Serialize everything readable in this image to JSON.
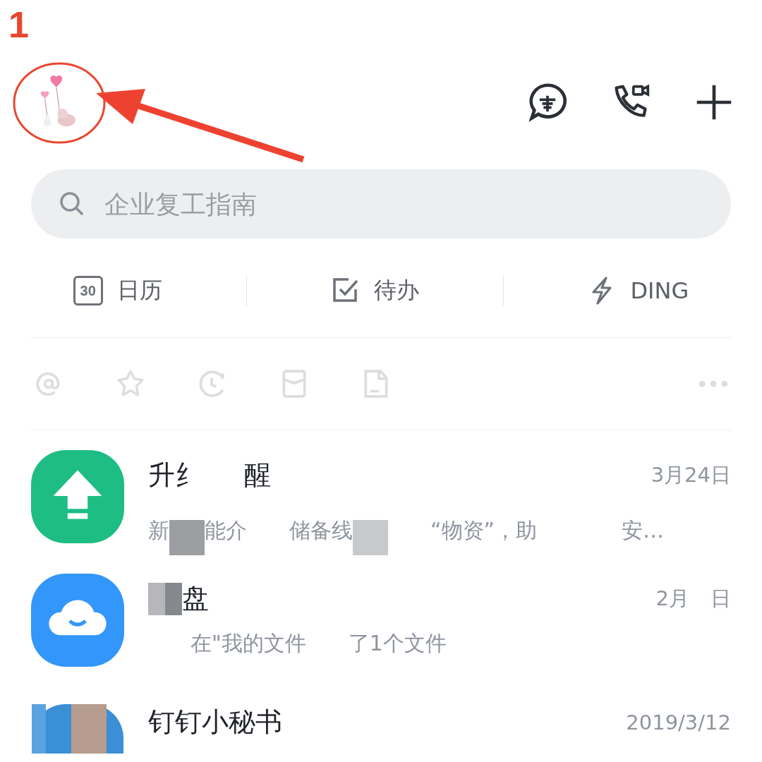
{
  "annotation": {
    "step": "1"
  },
  "header": {
    "icons": [
      {
        "kind": "encrypted-chat"
      },
      {
        "kind": "call"
      },
      {
        "kind": "add"
      }
    ]
  },
  "search": {
    "placeholder": "企业复工指南"
  },
  "shortcuts": [
    {
      "kind": "calendar",
      "icon_text": "30",
      "label": "日历"
    },
    {
      "kind": "todo",
      "label": "待办"
    },
    {
      "kind": "ding",
      "label": "DING"
    }
  ],
  "filters": [
    {
      "kind": "mention"
    },
    {
      "kind": "star"
    },
    {
      "kind": "history"
    },
    {
      "kind": "envelope"
    },
    {
      "kind": "file"
    },
    {
      "kind": "more"
    }
  ],
  "chats": [
    {
      "kind": "upgrade",
      "color": "#1dbd84",
      "title": [
        {
          "kind": "text",
          "text": "升纟"
        },
        {
          "kind": "gap"
        },
        {
          "kind": "text",
          "text": "醒"
        }
      ],
      "date": [
        {
          "kind": "text",
          "text": "3月24日"
        }
      ],
      "preview": [
        {
          "kind": "text",
          "text": "新"
        },
        {
          "kind": "blur",
          "color": "#9c9ea2"
        },
        {
          "kind": "text",
          "text": "能介"
        },
        {
          "kind": "gap"
        },
        {
          "kind": "text",
          "text": "储备线"
        },
        {
          "kind": "blur",
          "color": "#c8c9cc"
        },
        {
          "kind": "gap"
        },
        {
          "kind": "text",
          "text": "“物资”，助"
        },
        {
          "kind": "gap"
        },
        {
          "kind": "gap"
        },
        {
          "kind": "text",
          "text": "安…"
        }
      ]
    },
    {
      "kind": "cloud",
      "color": "#3296fa",
      "title": [
        {
          "kind": "blur",
          "color": "#b5b7ba"
        },
        {
          "kind": "blur",
          "color": "#85888c"
        },
        {
          "kind": "text",
          "text": "盘"
        }
      ],
      "date": [
        {
          "kind": "text",
          "text": "2月"
        },
        {
          "kind": "gap"
        },
        {
          "kind": "text",
          "text": "日"
        }
      ],
      "preview": [
        {
          "kind": "gap"
        },
        {
          "kind": "text",
          "text": "在\"我的文件"
        },
        {
          "kind": "gap"
        },
        {
          "kind": "text",
          "text": "了1个文件"
        }
      ]
    },
    {
      "kind": "picture",
      "color": "#3a8fd6",
      "title": [
        {
          "kind": "text",
          "text": "钉钉小秘书"
        }
      ],
      "date": [
        {
          "kind": "text",
          "text": "2019/3/12"
        }
      ]
    }
  ]
}
